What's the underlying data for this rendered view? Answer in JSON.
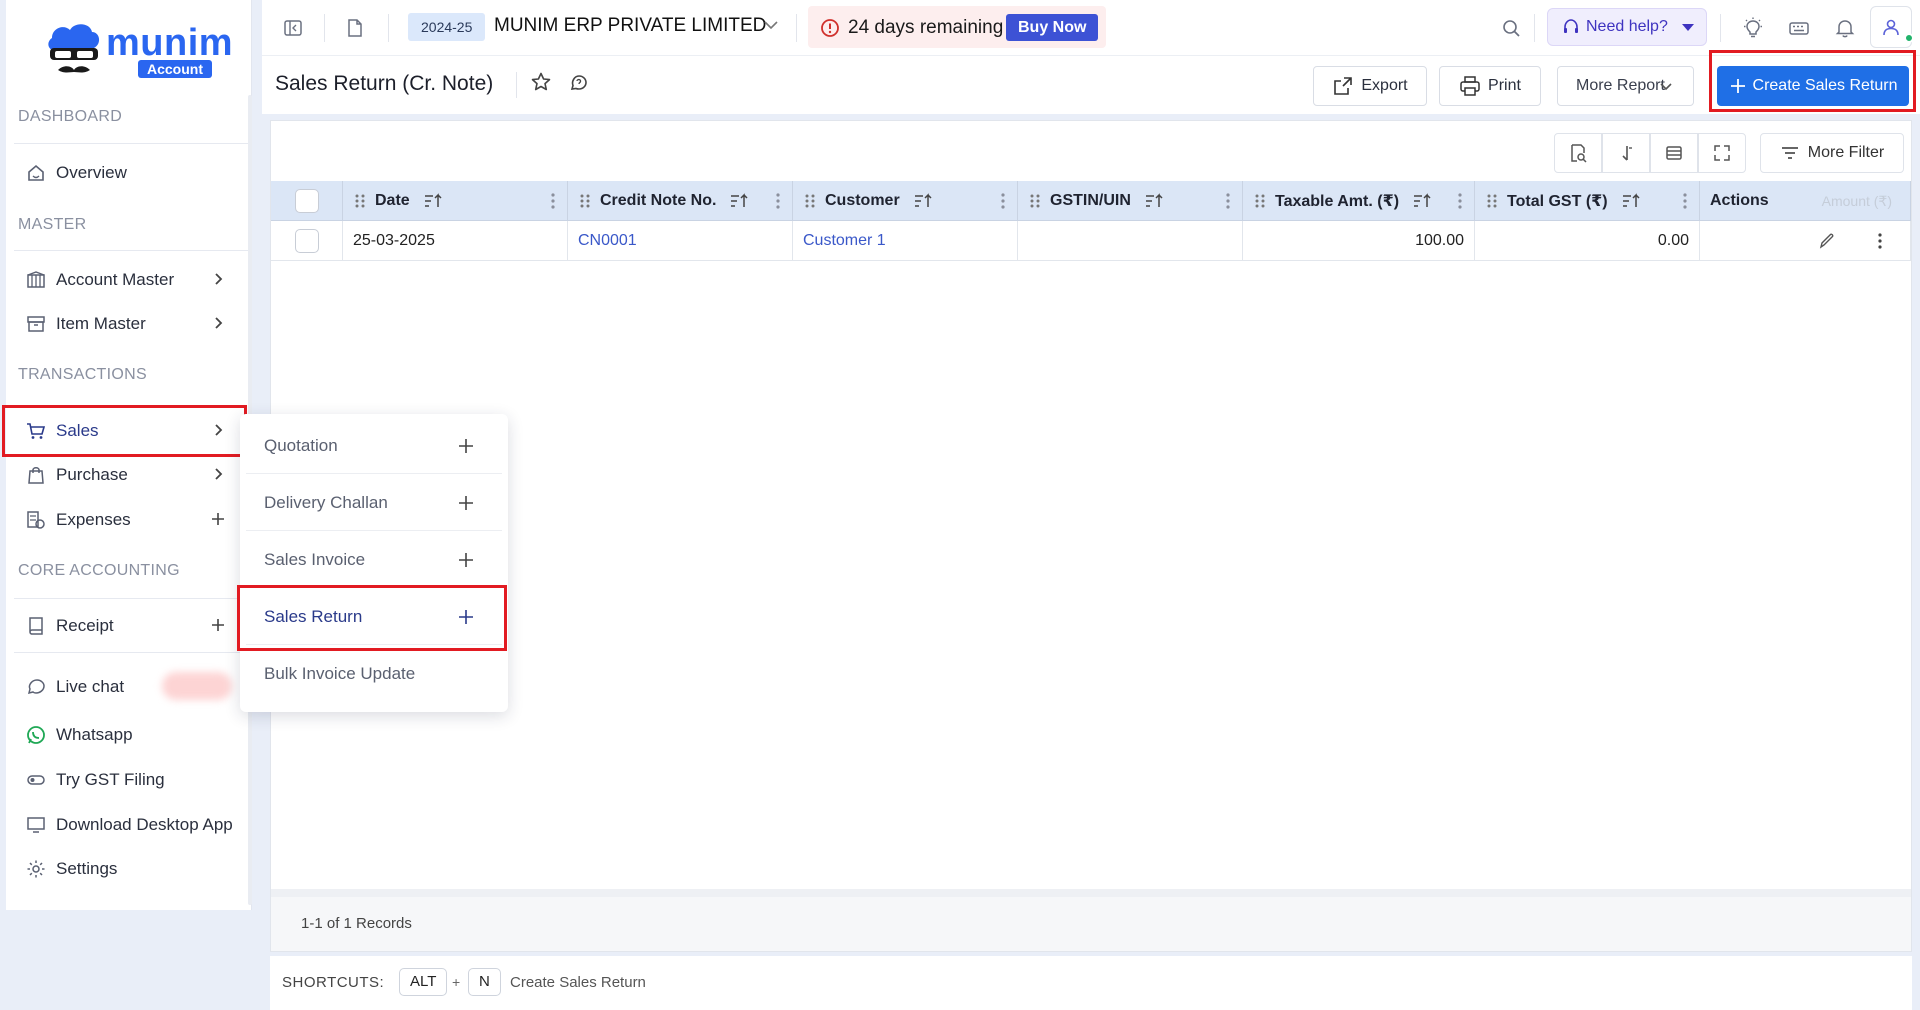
{
  "brand": {
    "name": "munim",
    "badge": "Account"
  },
  "sidebar": {
    "sections": {
      "dashboard": "DASHBOARD",
      "master": "MASTER",
      "transactions": "TRANSACTIONS",
      "core_accounting": "CORE ACCOUNTING"
    },
    "items": {
      "overview": "Overview",
      "account_master": "Account Master",
      "item_master": "Item Master",
      "sales": "Sales",
      "purchase": "Purchase",
      "expenses": "Expenses",
      "receipt": "Receipt",
      "live_chat": "Live chat",
      "whatsapp": "Whatsapp",
      "try_gst": "Try GST Filing",
      "download_app": "Download Desktop App",
      "settings": "Settings"
    }
  },
  "topbar": {
    "year": "2024-25",
    "company": "MUNIM ERP PRIVATE LIMITED",
    "trial_text": "24 days remaining",
    "buy_now": "Buy Now",
    "help": "Need help?"
  },
  "page": {
    "title": "Sales Return (Cr. Note)",
    "export": "Export",
    "print": "Print",
    "more_report": "More Report",
    "create": "Create Sales Return"
  },
  "toolbar": {
    "more_filter": "More Filter"
  },
  "table": {
    "columns": [
      "Date",
      "Credit Note No.",
      "Customer",
      "GSTIN/UIN",
      "Taxable Amt. (₹)",
      "Total GST (₹)",
      "Actions"
    ],
    "ghost_header": "Amount (₹)",
    "rows": [
      {
        "date": "25-03-2025",
        "credit_note": "CN0001",
        "customer": "Customer 1",
        "gstin": "",
        "taxable": "100.00",
        "gst": "0.00"
      }
    ]
  },
  "footer": {
    "records": "1-1 of 1 Records"
  },
  "shortcuts": {
    "label": "SHORTCUTS:",
    "key1": "ALT",
    "plus": "+",
    "key2": "N",
    "desc": "Create Sales Return"
  },
  "flyout": {
    "items": [
      "Quotation",
      "Delivery Challan",
      "Sales Invoice",
      "Sales Return",
      "Bulk Invoice Update"
    ]
  },
  "colors": {
    "accent": "#1f6fe6",
    "highlight": "#e21b22",
    "header_bg": "#dbe6f6",
    "link": "#3a58c9"
  }
}
